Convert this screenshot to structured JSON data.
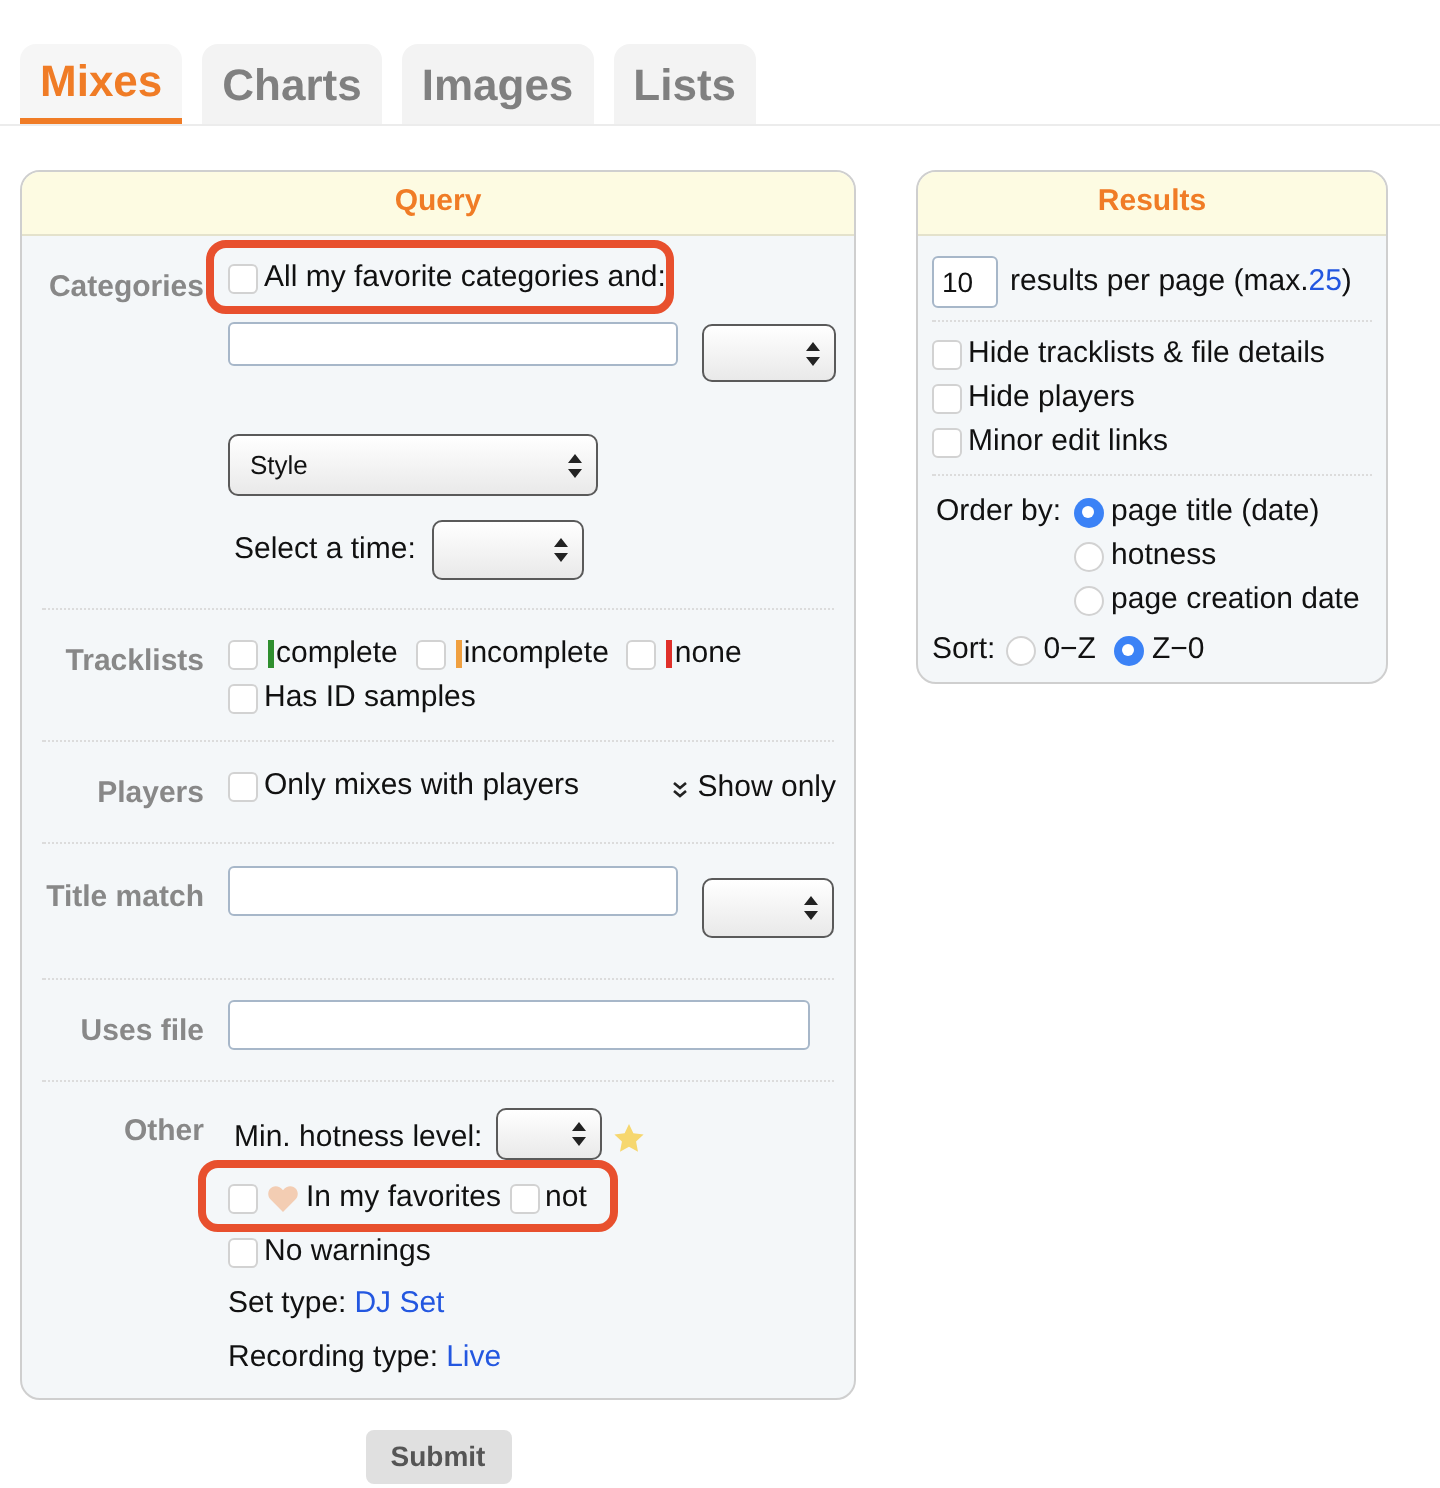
{
  "tabs": [
    {
      "label": "Mixes",
      "selected": true
    },
    {
      "label": "Charts",
      "selected": false
    },
    {
      "label": "Images",
      "selected": false
    },
    {
      "label": "Lists",
      "selected": false
    }
  ],
  "query": {
    "title": "Query",
    "sections": [
      {
        "kind": "categories",
        "label": "Categories",
        "favorite": {
          "label": "All my favorite categories and:",
          "checked": false,
          "highlighted": true
        },
        "style_select": "Style",
        "time_label": "Select a time:"
      },
      {
        "kind": "tracklists",
        "label": "Tracklists",
        "options": [
          {
            "label": "complete",
            "checked": false,
            "color": "#2f8f2f"
          },
          {
            "label": "incomplete",
            "checked": false,
            "color": "#f0a040"
          },
          {
            "label": "none",
            "checked": false,
            "color": "#e0302a"
          }
        ],
        "id_samples": {
          "label": "Has ID samples",
          "checked": false
        }
      },
      {
        "kind": "players",
        "label": "Players",
        "option": {
          "label": "Only mixes with players",
          "checked": false
        },
        "toggle": "Show only"
      },
      {
        "kind": "title_match",
        "label": "Title match"
      },
      {
        "kind": "uses_file",
        "label": "Uses file"
      },
      {
        "kind": "other",
        "label": "Other",
        "hotness_label": "Min. hotness level:",
        "favorites": {
          "label": "In my favorites",
          "checked": false,
          "not_label": "not",
          "not_checked": false,
          "highlighted": true
        },
        "no_warnings": {
          "label": "No warnings",
          "checked": false
        },
        "set_type": {
          "label": "Set type:",
          "link": "DJ Set"
        },
        "recording_type": {
          "label": "Recording type:",
          "link": "Live"
        }
      }
    ]
  },
  "submit": "Submit",
  "results": {
    "title": "Results",
    "per_page": {
      "value": "10",
      "text": "results per page (max.",
      "max": "25",
      "close": ")"
    },
    "options": [
      {
        "label": "Hide tracklists & file details",
        "checked": false
      },
      {
        "label": "Hide players",
        "checked": false
      },
      {
        "label": "Minor edit links",
        "checked": false
      }
    ],
    "order_by": {
      "label": "Order by:",
      "options": [
        {
          "label": "page title (date)",
          "selected": true
        },
        {
          "label": "hotness",
          "selected": false
        },
        {
          "label": "page creation date",
          "selected": false
        }
      ]
    },
    "sort": {
      "label": "Sort:",
      "options": [
        {
          "label": "0−Z",
          "selected": false
        },
        {
          "label": "Z−0",
          "selected": true
        }
      ]
    }
  }
}
